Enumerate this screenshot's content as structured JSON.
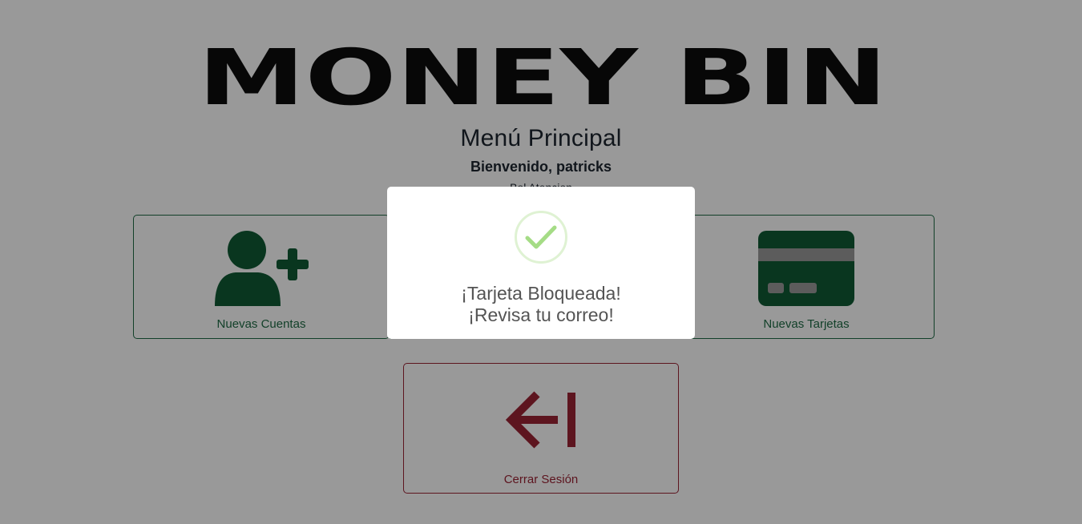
{
  "brand": {
    "logo_text": "MONEY BIN"
  },
  "header": {
    "title": "Menú Principal",
    "welcome": "Bienvenido, patricks",
    "obscured_line": "Bol Atencion"
  },
  "tiles": [
    {
      "label": "Nuevas Cuentas",
      "icon": "user-plus-icon"
    },
    {
      "label": "Nuevas Tarjetas",
      "icon": "credit-card-icon"
    }
  ],
  "logout": {
    "label": "Cerrar Sesión",
    "icon": "logout-arrow-icon"
  },
  "modal": {
    "icon": "success-check-icon",
    "line1": "¡Tarjeta Bloqueada!",
    "line2": "¡Revisa tu correo!"
  },
  "colors": {
    "accent_green": "#1e6b45",
    "icon_green": "#0f5a35",
    "logout_red": "#9b2335",
    "success_green": "#a5dc86",
    "overlay": "rgba(0,0,0,0.4)"
  }
}
